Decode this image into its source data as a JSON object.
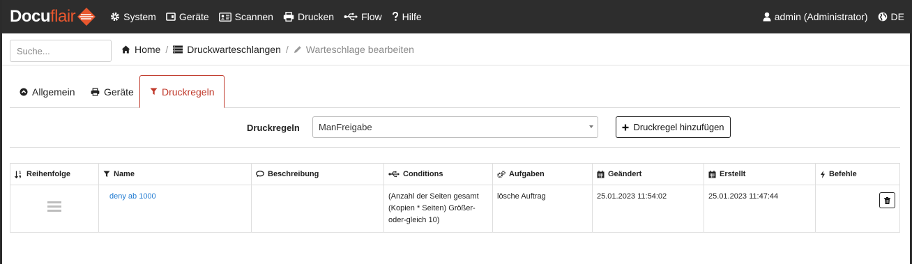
{
  "brand": {
    "docu": "Docu",
    "flair": "flair",
    "accent": "#e8572e",
    "mark_icon": "docuflair-diamond-icon"
  },
  "nav": {
    "items": [
      {
        "label": "System",
        "icon": "gear-icon"
      },
      {
        "label": "Geräte",
        "icon": "device-icon"
      },
      {
        "label": "Scannen",
        "icon": "id-card-icon"
      },
      {
        "label": "Drucken",
        "icon": "printer-icon"
      },
      {
        "label": "Flow",
        "icon": "usb-icon"
      },
      {
        "label": "Hilfe",
        "icon": "question-icon"
      }
    ],
    "user": "admin (Administrator)",
    "language": "DE"
  },
  "search": {
    "placeholder": "Suche..."
  },
  "breadcrumb": {
    "home": "Home",
    "queues": "Druckwarteschlangen",
    "current": "Warteschlage bearbeiten",
    "separator": "/"
  },
  "tabs": [
    {
      "label": "Allgemein",
      "icon": "chevron-up-circle-icon"
    },
    {
      "label": "Geräte",
      "icon": "printer-icon"
    },
    {
      "label": "Druckregeln",
      "icon": "filter-icon",
      "active": true
    }
  ],
  "rules": {
    "label": "Druckregeln",
    "selected": "ManFreigabe",
    "add_button": "Druckregel hinzufügen"
  },
  "table": {
    "headers": {
      "order": "Reihenfolge",
      "name": "Name",
      "description": "Beschreibung",
      "conditions": "Conditions",
      "tasks": "Aufgaben",
      "changed": "Geändert",
      "created": "Erstellt",
      "commands": "Befehle"
    },
    "rows": [
      {
        "name": "deny ab 1000",
        "description": "",
        "conditions": "(Anzahl der Seiten gesamt (Kopien * Seiten) Größer-oder-gleich 10)",
        "tasks": "lösche Auftrag",
        "changed": "25.01.2023 11:54:02",
        "created": "25.01.2023 11:47:44"
      }
    ]
  },
  "colors": {
    "navbar": "#2d2d2d",
    "active_tab": "#c0392b",
    "link": "#1f7ad1"
  }
}
